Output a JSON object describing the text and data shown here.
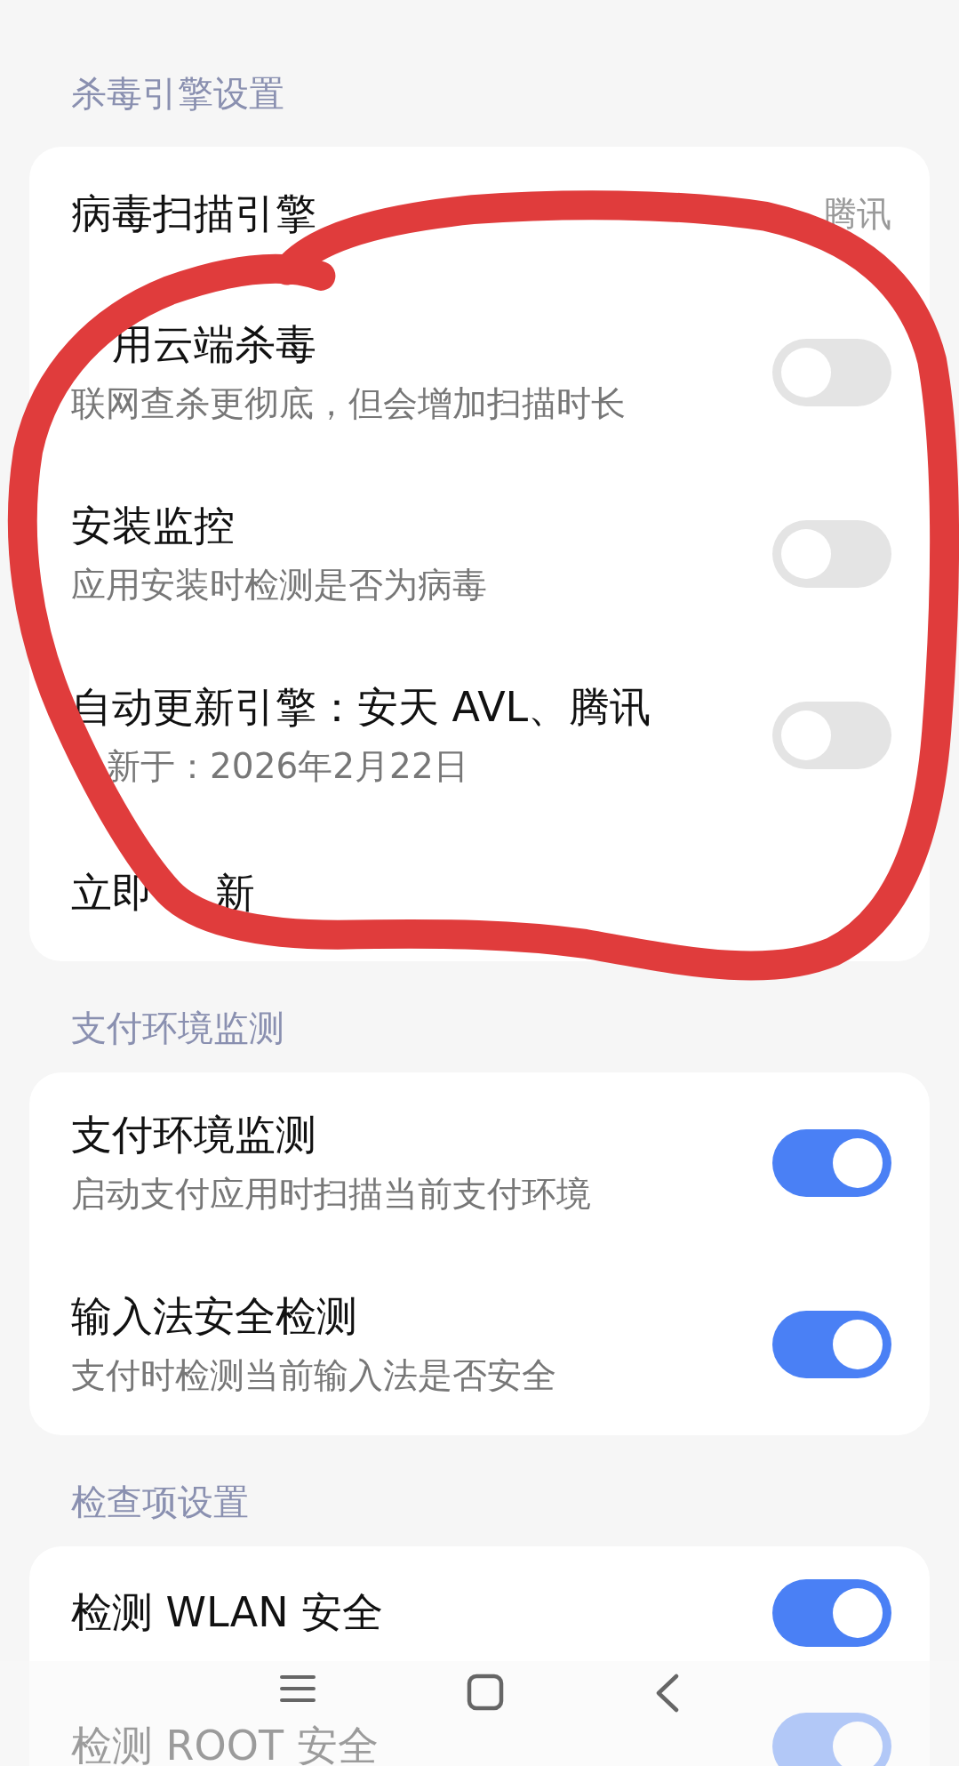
{
  "sections": [
    {
      "title": "杀毒引擎设置",
      "items": [
        {
          "kind": "value",
          "title": "病毒扫描引擎",
          "value": "腾讯"
        },
        {
          "kind": "toggle",
          "title": "用云端杀毒",
          "title_covered_start": true,
          "subtitle": "联网查杀更彻底，但会增加扫描时长",
          "on": false
        },
        {
          "kind": "toggle",
          "title": "安装监控",
          "subtitle": "应用安装时检测是否为病毒",
          "on": false
        },
        {
          "kind": "toggle",
          "title": "自动更新引擎：安天 AVL、腾讯",
          "subtitle": "新于：2026年2月22日",
          "subtitle_covered_start": true,
          "on": false
        },
        {
          "kind": "action",
          "title": "立即",
          "title_tail": "新"
        }
      ]
    },
    {
      "title": "支付环境监测",
      "items": [
        {
          "kind": "toggle",
          "title": "支付环境监测",
          "subtitle": "启动支付应用时扫描当前支付环境",
          "on": true
        },
        {
          "kind": "toggle",
          "title": "输入法安全检测",
          "subtitle": "支付时检测当前输入法是否安全",
          "on": true
        }
      ]
    },
    {
      "title": "检查项设置",
      "items": [
        {
          "kind": "toggle",
          "title": "检测 WLAN 安全",
          "on": true
        },
        {
          "kind": "toggle",
          "title": "检测 ROOT 安全",
          "on": true
        }
      ]
    }
  ]
}
